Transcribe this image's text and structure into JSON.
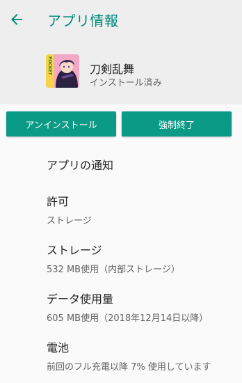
{
  "header": {
    "title": "アプリ情報",
    "back_icon": "arrow-back-icon"
  },
  "app": {
    "name": "刀剣乱舞",
    "status": "インストール済み",
    "icon_text": "POCKET"
  },
  "actions": {
    "uninstall_label": "アンインストール",
    "force_stop_label": "強制終了"
  },
  "settings": {
    "notifications": {
      "title": "アプリの通知"
    },
    "permissions": {
      "title": "許可",
      "summary": "ストレージ"
    },
    "storage": {
      "title": "ストレージ",
      "summary": "532 MB使用（内部ストレージ）"
    },
    "data_usage": {
      "title": "データ使用量",
      "summary": "605 MB使用（2018年12月14日以降）"
    },
    "battery": {
      "title": "電池",
      "summary": "前回のフル充電以降 7% 使用しています"
    }
  },
  "colors": {
    "accent": "#00897b",
    "button": "#0a9a86",
    "header_bg": "#eeeeee",
    "body_bg": "#fafafa"
  }
}
